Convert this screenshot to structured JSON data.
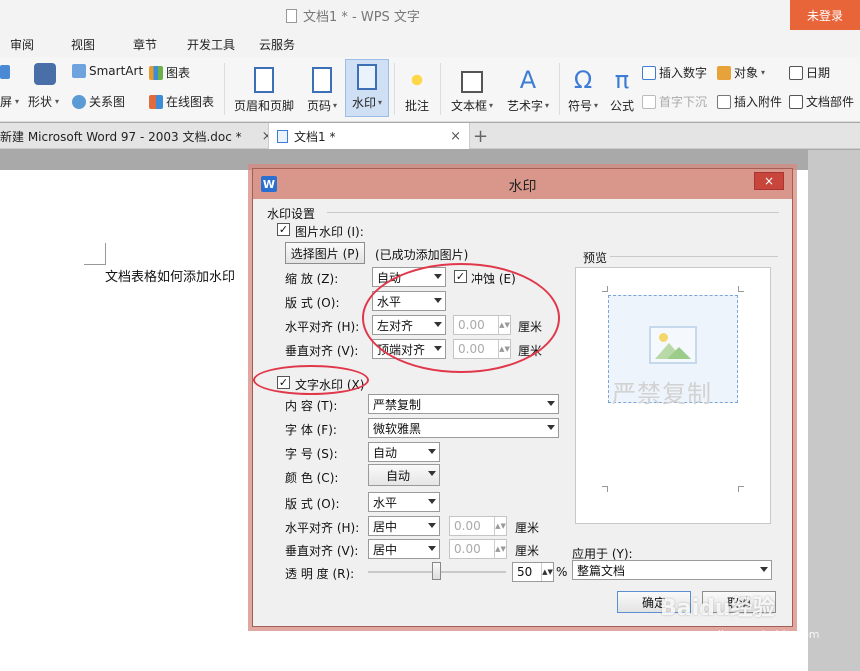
{
  "window": {
    "title": "文档1 * - WPS 文字",
    "login_label": "未登录"
  },
  "menu": {
    "tabs": [
      "审阅",
      "视图",
      "章节",
      "开发工具",
      "云服务"
    ]
  },
  "ribbon": {
    "screen_cut": "屏",
    "shape": "形状",
    "smartart": "SmartArt",
    "relation_chart": "关系图",
    "chart": "图表",
    "online_chart": "在线图表",
    "header_footer": "页眉和页脚",
    "page_number": "页码",
    "watermark": "水印",
    "comment": "批注",
    "textbox": "文本框",
    "wordart": "艺术字",
    "symbol": "符号",
    "formula": "公式",
    "insert_number": "插入数字",
    "drop_cap": "首字下沉",
    "object": "对象",
    "insert_attachment": "插入附件",
    "date": "日期",
    "doc_parts": "文档部件"
  },
  "doc_tabs": {
    "tab1": "新建 Microsoft Word 97 - 2003 文档.doc *",
    "tab2": "文档1 *",
    "close": "×",
    "add": "+"
  },
  "document": {
    "text": "文档表格如何添加水印"
  },
  "dialog": {
    "title": "水印",
    "close": "×",
    "group_label": "水印设置",
    "picture": {
      "checkbox_label": "图片水印 (I):",
      "checked": true,
      "select_button": "选择图片 (P)",
      "status": "(已成功添加图片)",
      "scale_label": "缩   放 (Z):",
      "scale_value": "自动",
      "washout_label": "冲蚀 (E)",
      "washout_checked": true,
      "layout_label": "版   式 (O):",
      "layout_value": "水平",
      "halign_label": "水平对齐 (H):",
      "halign_value": "左对齐",
      "halign_offset": "0.00",
      "valign_label": "垂直对齐 (V):",
      "valign_value": "顶端对齐",
      "valign_offset": "0.00",
      "unit": "厘米"
    },
    "text": {
      "checkbox_label": "文字水印 (X)",
      "checked": true,
      "content_label": "内   容 (T):",
      "content_value": "严禁复制",
      "font_label": "字   体 (F):",
      "font_value": "微软雅黑",
      "size_label": "字   号 (S):",
      "size_value": "自动",
      "color_label": "颜   色 (C):",
      "color_value": "自动",
      "layout_label": "版   式 (O):",
      "layout_value": "水平",
      "halign_label": "水平对齐 (H):",
      "halign_value": "居中",
      "halign_offset": "0.00",
      "valign_label": "垂直对齐 (V):",
      "valign_value": "居中",
      "valign_offset": "0.00",
      "unit": "厘米",
      "transparency_label": "透 明 度 (R):",
      "transparency_value": "50",
      "transparency_unit": "%"
    },
    "preview": {
      "label": "预览",
      "watermark_text": "严禁复制"
    },
    "apply_to": {
      "label": "应用于 (Y):",
      "value": "整篇文档"
    },
    "ok_button": "确定",
    "cancel_button": "取消"
  },
  "site_watermark": {
    "brand": "Baidu经验",
    "url": "jingyan.baidu.com"
  },
  "colors": {
    "dialog_title_bg": "#d9978b",
    "login_bg": "#e8653a",
    "highlight_ellipse": "#e0384a",
    "ribbon_selected": "#cfe0f5"
  }
}
